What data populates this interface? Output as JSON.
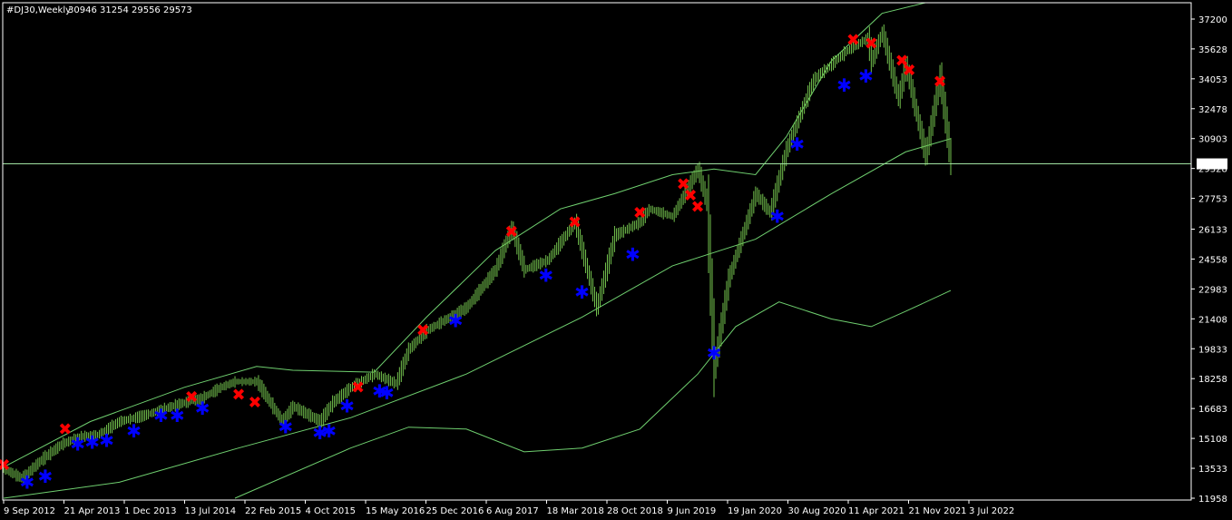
{
  "header": {
    "symbol": "#DJ30,Weekly",
    "ohlc": "30946 31254 29556 29573"
  },
  "colors": {
    "background": "#000000",
    "frame": "#ffffff",
    "bars": "#74c34e",
    "bands": "#6fcf6f",
    "price_line": "#9fe0a0",
    "sell_marker": "#ff0000",
    "buy_marker": "#0000ff",
    "price_label_bg": "#ffffff",
    "price_label_fg": "#000000"
  },
  "chart_data": {
    "type": "ohlc",
    "symbol": "#DJ30",
    "timeframe": "Weekly",
    "last_price": 29573,
    "last_price_label": "29573",
    "y_ticks": [
      37200,
      35628,
      34053,
      32478,
      30903,
      29328,
      27753,
      26133,
      24558,
      22983,
      21408,
      19833,
      18258,
      16683,
      15108,
      13533,
      11958
    ],
    "y_tick_labels": [
      "37200",
      "35628",
      "34053",
      "32478",
      "30903",
      "29328",
      "27753",
      "26133",
      "24558",
      "22983",
      "21408",
      "19833",
      "18258",
      "16683",
      "15108",
      "13533",
      "11958"
    ],
    "x_tick_labels": [
      "9 Sep 2012",
      "21 Apr 2013",
      "1 Dec 2013",
      "13 Jul 2014",
      "22 Feb 2015",
      "4 Oct 2015",
      "15 May 2016",
      "25 Dec 2016",
      "6 Aug 2017",
      "18 Mar 2018",
      "28 Oct 2018",
      "9 Jun 2019",
      "19 Jan 2020",
      "30 Aug 2020",
      "11 Apr 2021",
      "21 Nov 2021",
      "3 Jul 2022"
    ],
    "price_path": [
      [
        "2012-09-09",
        13500
      ],
      [
        "2012-11-18",
        13000
      ],
      [
        "2013-02-03",
        14000
      ],
      [
        "2013-04-21",
        14800
      ],
      [
        "2013-06-30",
        15200
      ],
      [
        "2013-09-08",
        15300
      ],
      [
        "2013-12-01",
        16000
      ],
      [
        "2014-03-02",
        16300
      ],
      [
        "2014-07-13",
        16900
      ],
      [
        "2014-10-12",
        17200
      ],
      [
        "2014-12-28",
        17800
      ],
      [
        "2015-02-22",
        18100
      ],
      [
        "2015-05-17",
        18100
      ],
      [
        "2015-08-23",
        16000
      ],
      [
        "2015-10-04",
        16800
      ],
      [
        "2016-01-17",
        16000
      ],
      [
        "2016-03-06",
        17000
      ],
      [
        "2016-05-15",
        17800
      ],
      [
        "2016-08-14",
        18500
      ],
      [
        "2016-11-06",
        18000
      ],
      [
        "2016-12-25",
        19800
      ],
      [
        "2017-03-05",
        20800
      ],
      [
        "2017-08-06",
        22000
      ],
      [
        "2017-11-26",
        24000
      ],
      [
        "2018-01-28",
        26200
      ],
      [
        "2018-03-18",
        24000
      ],
      [
        "2018-06-17",
        24500
      ],
      [
        "2018-09-30",
        26500
      ],
      [
        "2018-12-23",
        22000
      ],
      [
        "2019-03-03",
        25800
      ],
      [
        "2019-06-09",
        26500
      ],
      [
        "2019-07-14",
        27200
      ],
      [
        "2019-10-13",
        26800
      ],
      [
        "2020-01-19",
        29300
      ],
      [
        "2020-02-23",
        27500
      ],
      [
        "2020-03-22",
        18800
      ],
      [
        "2020-05-17",
        23500
      ],
      [
        "2020-08-30",
        28000
      ],
      [
        "2020-10-25",
        27000
      ],
      [
        "2020-12-27",
        30300
      ],
      [
        "2021-04-11",
        34000
      ],
      [
        "2021-08-15",
        35500
      ],
      [
        "2021-11-07",
        36200
      ],
      [
        "2021-11-21",
        35000
      ],
      [
        "2022-01-02",
        36500
      ],
      [
        "2022-03-06",
        33000
      ],
      [
        "2022-04-03",
        34800
      ],
      [
        "2022-06-19",
        30000
      ],
      [
        "2022-08-14",
        34200
      ],
      [
        "2022-09-25",
        29573
      ]
    ],
    "upper_band": [
      [
        "2012-09-09",
        13600
      ],
      [
        "2013-08-11",
        16000
      ],
      [
        "2014-08-10",
        17800
      ],
      [
        "2015-05-17",
        18900
      ],
      [
        "2015-10-04",
        18700
      ],
      [
        "2016-08-14",
        18600
      ],
      [
        "2017-03-05",
        21500
      ],
      [
        "2017-11-26",
        25000
      ],
      [
        "2018-08-05",
        27200
      ],
      [
        "2019-03-03",
        28000
      ],
      [
        "2019-10-13",
        29000
      ],
      [
        "2020-03-22",
        29300
      ],
      [
        "2020-08-30",
        29000
      ],
      [
        "2020-12-27",
        31000
      ],
      [
        "2021-06-20",
        35000
      ],
      [
        "2022-01-02",
        37500
      ],
      [
        "2022-06-19",
        38500
      ]
    ],
    "middle_band": [
      [
        "2012-09-09",
        11958
      ],
      [
        "2013-12-01",
        12800
      ],
      [
        "2015-03-08",
        14600
      ],
      [
        "2016-05-15",
        16200
      ],
      [
        "2017-08-06",
        18500
      ],
      [
        "2018-10-28",
        21500
      ],
      [
        "2019-10-13",
        24200
      ],
      [
        "2020-08-30",
        25600
      ],
      [
        "2021-06-20",
        28000
      ],
      [
        "2022-04-03",
        30200
      ],
      [
        "2022-09-25",
        30900
      ]
    ],
    "lower_band": [
      [
        "2015-02-22",
        11958
      ],
      [
        "2016-05-15",
        14600
      ],
      [
        "2016-12-25",
        15700
      ],
      [
        "2017-08-06",
        15600
      ],
      [
        "2018-03-18",
        14400
      ],
      [
        "2018-10-28",
        14600
      ],
      [
        "2019-06-09",
        15600
      ],
      [
        "2020-01-19",
        18500
      ],
      [
        "2020-06-14",
        21000
      ],
      [
        "2020-11-29",
        22300
      ],
      [
        "2021-06-20",
        21400
      ],
      [
        "2021-11-21",
        21000
      ],
      [
        "2022-04-03",
        21800
      ],
      [
        "2022-09-25",
        22900
      ]
    ],
    "sell_signals": [
      [
        "2012-09-09",
        13700
      ],
      [
        "2013-05-05",
        15600
      ],
      [
        "2014-09-07",
        17300
      ],
      [
        "2015-03-08",
        17400
      ],
      [
        "2015-05-10",
        17000
      ],
      [
        "2016-06-12",
        17800
      ],
      [
        "2017-02-19",
        20800
      ],
      [
        "2018-01-28",
        26000
      ],
      [
        "2018-09-30",
        26500
      ],
      [
        "2019-06-09",
        27000
      ],
      [
        "2019-11-24",
        28500
      ],
      [
        "2019-12-22",
        27900
      ],
      [
        "2020-01-19",
        27300
      ],
      [
        "2021-09-12",
        36100
      ],
      [
        "2021-11-21",
        35900
      ],
      [
        "2022-03-20",
        35000
      ],
      [
        "2022-04-17",
        34500
      ],
      [
        "2022-08-14",
        33900
      ]
    ],
    "buy_signals": [
      [
        "2012-12-09",
        12800
      ],
      [
        "2013-02-17",
        13100
      ],
      [
        "2013-06-23",
        14800
      ],
      [
        "2013-08-18",
        14900
      ],
      [
        "2013-10-13",
        15000
      ],
      [
        "2014-01-26",
        15500
      ],
      [
        "2014-05-11",
        16300
      ],
      [
        "2014-07-13",
        16300
      ],
      [
        "2014-10-19",
        16700
      ],
      [
        "2015-09-06",
        15700
      ],
      [
        "2016-01-17",
        15400
      ],
      [
        "2016-02-21",
        15500
      ],
      [
        "2016-05-01",
        16800
      ],
      [
        "2016-09-04",
        17600
      ],
      [
        "2016-10-02",
        17500
      ],
      [
        "2017-06-25",
        21300
      ],
      [
        "2018-06-10",
        23700
      ],
      [
        "2018-10-28",
        22800
      ],
      [
        "2019-05-12",
        24800
      ],
      [
        "2020-03-22",
        19600
      ],
      [
        "2020-11-22",
        26800
      ],
      [
        "2021-02-07",
        30600
      ],
      [
        "2021-08-08",
        33700
      ],
      [
        "2021-10-31",
        34200
      ]
    ]
  }
}
